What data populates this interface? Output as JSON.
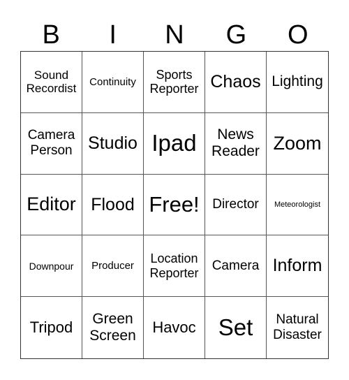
{
  "header": [
    "B",
    "I",
    "N",
    "G",
    "O"
  ],
  "cells": [
    {
      "text": "Sound Recordist",
      "size": "s17"
    },
    {
      "text": "Continuity",
      "size": "s15"
    },
    {
      "text": "Sports Reporter",
      "size": "s18"
    },
    {
      "text": "Chaos",
      "size": "s25"
    },
    {
      "text": "Lighting",
      "size": "s21"
    },
    {
      "text": "Camera Person",
      "size": "s19"
    },
    {
      "text": "Studio",
      "size": "s25"
    },
    {
      "text": "Ipad",
      "size": "s33"
    },
    {
      "text": "News Reader",
      "size": "s21"
    },
    {
      "text": "Zoom",
      "size": "s27"
    },
    {
      "text": "Editor",
      "size": "s27"
    },
    {
      "text": "Flood",
      "size": "s25"
    },
    {
      "text": "Free!",
      "size": "s31"
    },
    {
      "text": "Director",
      "size": "s19"
    },
    {
      "text": "Meteorologist",
      "size": "s11"
    },
    {
      "text": "Downpour",
      "size": "s14"
    },
    {
      "text": "Producer",
      "size": "s15"
    },
    {
      "text": "Location Reporter",
      "size": "s18"
    },
    {
      "text": "Camera",
      "size": "s19"
    },
    {
      "text": "Inform",
      "size": "s25"
    },
    {
      "text": "Tripod",
      "size": "s22"
    },
    {
      "text": "Green Screen",
      "size": "s21"
    },
    {
      "text": "Havoc",
      "size": "s22"
    },
    {
      "text": "Set",
      "size": "s33"
    },
    {
      "text": "Natural Disaster",
      "size": "s19"
    }
  ]
}
